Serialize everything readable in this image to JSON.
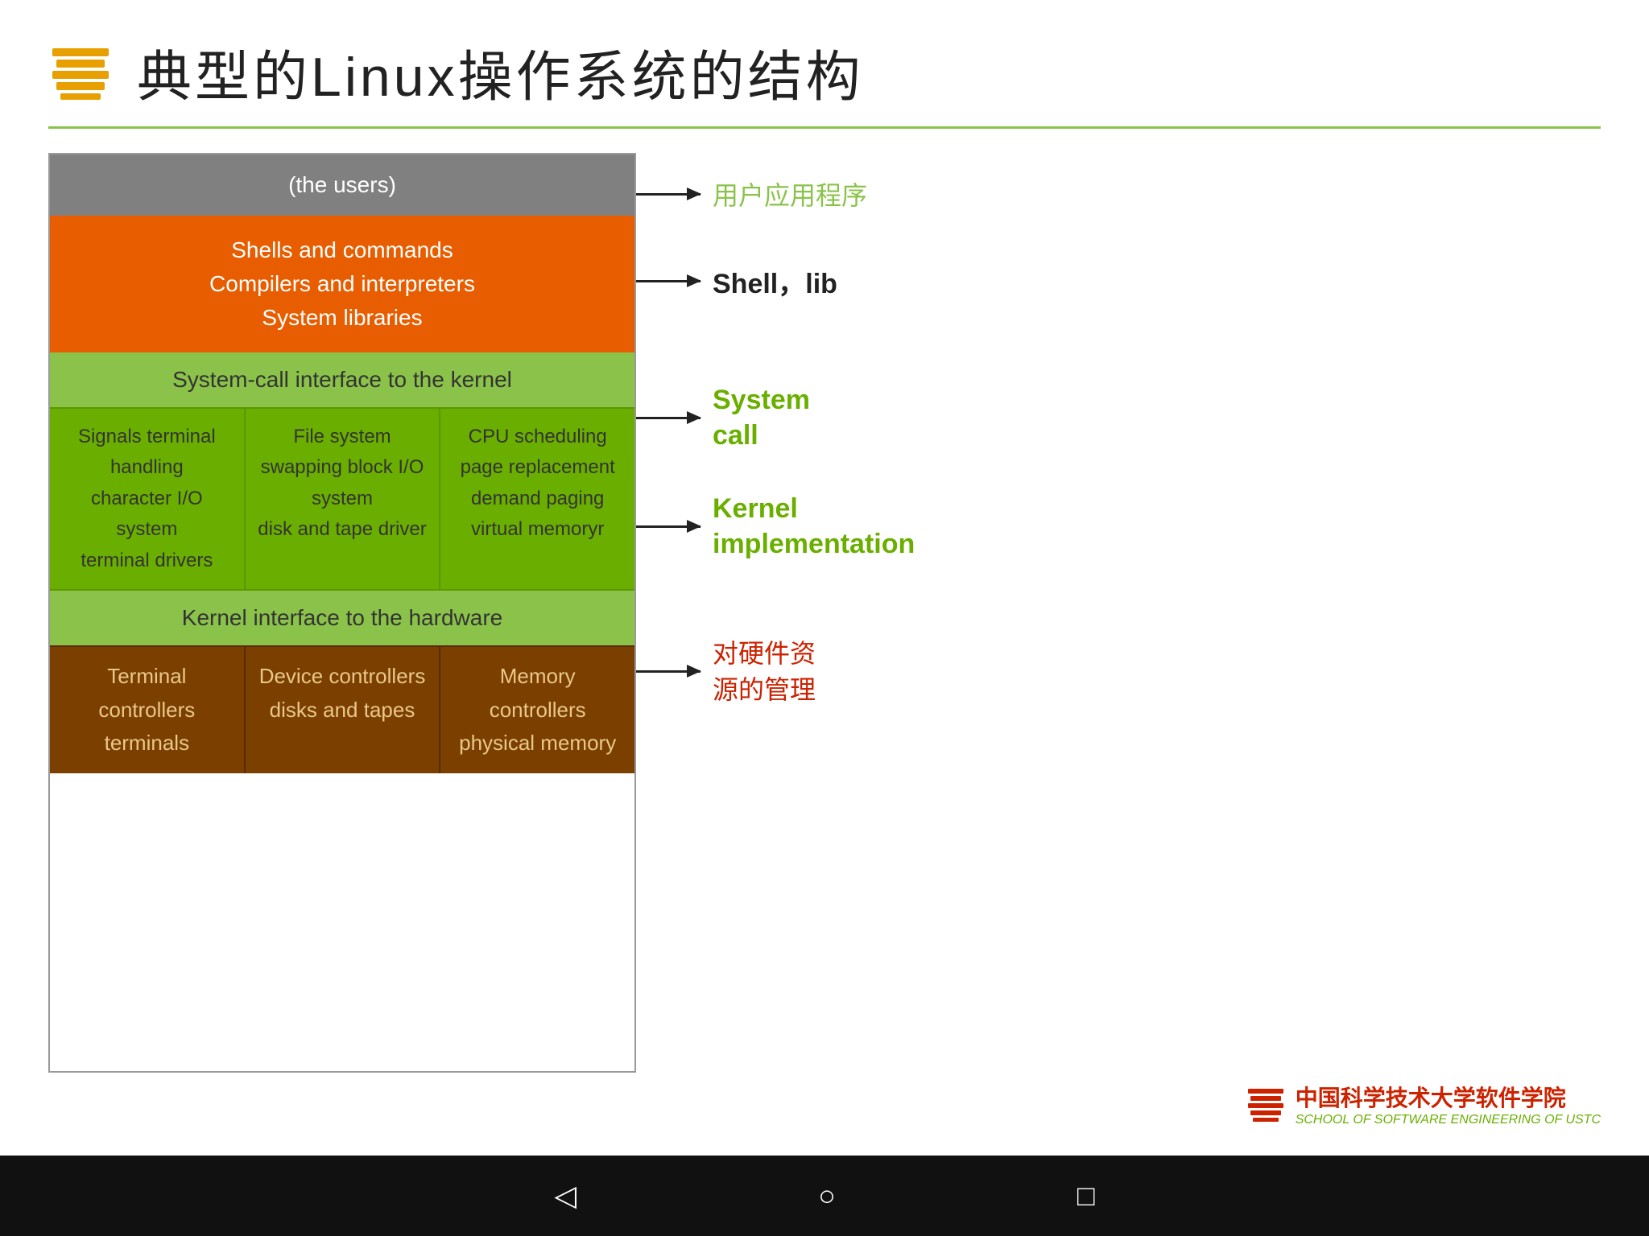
{
  "header": {
    "title": "典型的Linux操作系统的结构"
  },
  "diagram": {
    "users_label": "(the users)",
    "shell_line1": "Shells and commands",
    "shell_line2": "Compilers and interpreters",
    "shell_line3": "System libraries",
    "syscall_label": "System-call interface to the kernel",
    "kernel_col1_line1": "Signals terminal",
    "kernel_col1_line2": "handling",
    "kernel_col1_line3": "character I/O system",
    "kernel_col1_line4": "terminal    drivers",
    "kernel_col2_line1": "File system",
    "kernel_col2_line2": "swapping block I/O",
    "kernel_col2_line3": "system",
    "kernel_col2_line4": "disk and tape driver",
    "kernel_col3_line1": "CPU scheduling",
    "kernel_col3_line2": "page replacement",
    "kernel_col3_line3": "demand paging",
    "kernel_col3_line4": "virtual memoryr",
    "hw_interface": "Kernel interface to the hardware",
    "ctrl_col1_line1": "Terminal controllers",
    "ctrl_col1_line2": "terminals",
    "ctrl_col2_line1": "Device controllers",
    "ctrl_col2_line2": "disks and tapes",
    "ctrl_col3_line1": "Memory controllers",
    "ctrl_col3_line2": "physical memory"
  },
  "annotations": {
    "users": "用户应用程序",
    "shell": "Shell，lib",
    "syscall_line1": "System",
    "syscall_line2": "call",
    "kernel_line1": "Kernel",
    "kernel_line2": "implementation",
    "hw_line1": "对硬件资",
    "hw_line2": "源的管理"
  },
  "footer": {
    "cn_text": "中国科学技术大学软件学院",
    "en_text": "SCHOOL OF SOFTWARE ENGINEERING OF USTC"
  },
  "nav": {
    "back": "◁",
    "home": "○",
    "recent": "□"
  }
}
